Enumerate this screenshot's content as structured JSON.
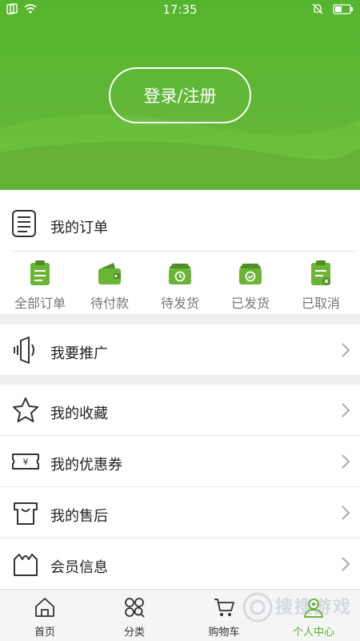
{
  "status_bar": {
    "time": "17:35"
  },
  "header": {
    "login_label": "登录/注册"
  },
  "orders": {
    "title": "我的订单",
    "items": [
      {
        "label": "全部订单",
        "icon": "clipboard-icon"
      },
      {
        "label": "待付款",
        "icon": "wallet-icon"
      },
      {
        "label": "待发货",
        "icon": "box-clock-icon"
      },
      {
        "label": "已发货",
        "icon": "box-check-icon"
      },
      {
        "label": "已取消",
        "icon": "clipboard-cancel-icon"
      }
    ]
  },
  "menu": {
    "promote": "我要推广",
    "favorites": "我的收藏",
    "coupons": "我的优惠券",
    "after_sales": "我的售后",
    "member_info": "会员信息"
  },
  "tabbar": {
    "tabs": [
      {
        "label": "首页",
        "icon": "home-icon"
      },
      {
        "label": "分类",
        "icon": "category-icon"
      },
      {
        "label": "购物车",
        "icon": "cart-icon"
      },
      {
        "label": "个人中心",
        "icon": "user-icon"
      }
    ],
    "active_index": 3
  },
  "watermark": {
    "text": "搜搜游戏"
  },
  "colors": {
    "brand_green": "#5fb634",
    "active_tab": "#5aaf2c"
  }
}
